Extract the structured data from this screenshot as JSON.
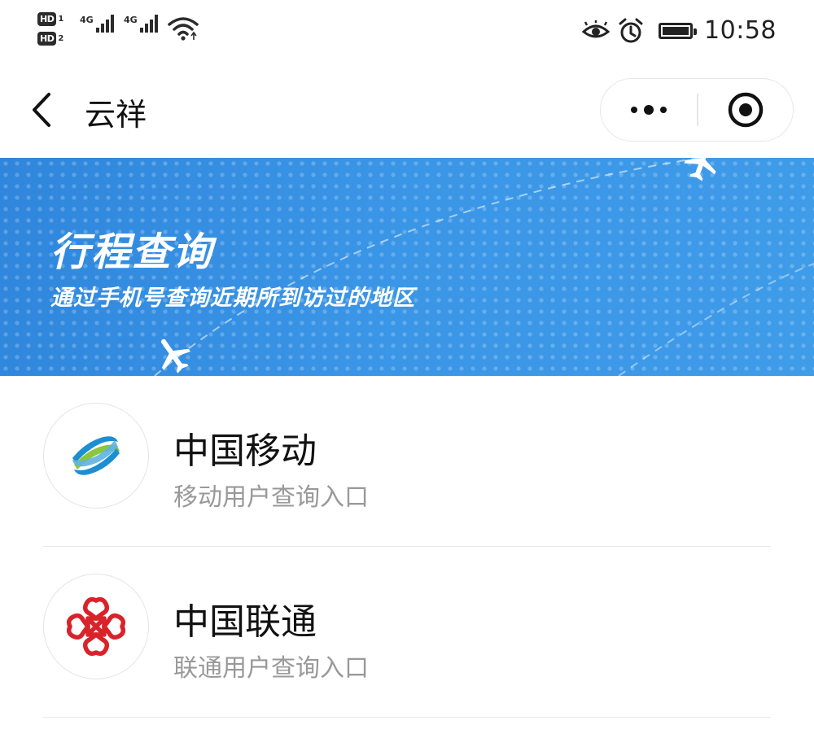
{
  "status_bar": {
    "sim1_label": "HD",
    "sim1_index": "1",
    "sim2_label": "HD",
    "sim2_index": "2",
    "network1": "4G",
    "network2": "4G",
    "time": "10:58"
  },
  "nav": {
    "title": "云祥"
  },
  "banner": {
    "title": "行程查询",
    "subtitle": "通过手机号查询近期所到访过的地区"
  },
  "carriers": [
    {
      "name": "中国移动",
      "desc": "移动用户查询入口",
      "logo_icon": "china-mobile-logo-icon"
    },
    {
      "name": "中国联通",
      "desc": "联通用户查询入口",
      "logo_icon": "china-unicom-logo-icon"
    }
  ],
  "colors": {
    "banner_blue": "#3a95e6",
    "mobile_blue": "#1c8fd1",
    "mobile_green": "#8cc63f",
    "unicom_red": "#d8232a",
    "desc_gray": "#999999"
  }
}
